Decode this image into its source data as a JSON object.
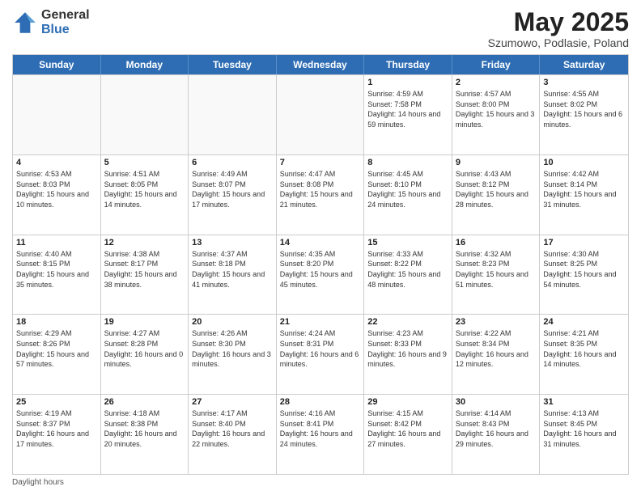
{
  "logo": {
    "general": "General",
    "blue": "Blue"
  },
  "title": {
    "month_year": "May 2025",
    "location": "Szumowo, Podlasie, Poland"
  },
  "days_of_week": [
    "Sunday",
    "Monday",
    "Tuesday",
    "Wednesday",
    "Thursday",
    "Friday",
    "Saturday"
  ],
  "weeks": [
    [
      {
        "day": "",
        "detail": "",
        "empty": true
      },
      {
        "day": "",
        "detail": "",
        "empty": true
      },
      {
        "day": "",
        "detail": "",
        "empty": true
      },
      {
        "day": "",
        "detail": "",
        "empty": true
      },
      {
        "day": "1",
        "detail": "Sunrise: 4:59 AM\nSunset: 7:58 PM\nDaylight: 14 hours\nand 59 minutes.",
        "empty": false
      },
      {
        "day": "2",
        "detail": "Sunrise: 4:57 AM\nSunset: 8:00 PM\nDaylight: 15 hours\nand 3 minutes.",
        "empty": false
      },
      {
        "day": "3",
        "detail": "Sunrise: 4:55 AM\nSunset: 8:02 PM\nDaylight: 15 hours\nand 6 minutes.",
        "empty": false
      }
    ],
    [
      {
        "day": "4",
        "detail": "Sunrise: 4:53 AM\nSunset: 8:03 PM\nDaylight: 15 hours\nand 10 minutes.",
        "empty": false
      },
      {
        "day": "5",
        "detail": "Sunrise: 4:51 AM\nSunset: 8:05 PM\nDaylight: 15 hours\nand 14 minutes.",
        "empty": false
      },
      {
        "day": "6",
        "detail": "Sunrise: 4:49 AM\nSunset: 8:07 PM\nDaylight: 15 hours\nand 17 minutes.",
        "empty": false
      },
      {
        "day": "7",
        "detail": "Sunrise: 4:47 AM\nSunset: 8:08 PM\nDaylight: 15 hours\nand 21 minutes.",
        "empty": false
      },
      {
        "day": "8",
        "detail": "Sunrise: 4:45 AM\nSunset: 8:10 PM\nDaylight: 15 hours\nand 24 minutes.",
        "empty": false
      },
      {
        "day": "9",
        "detail": "Sunrise: 4:43 AM\nSunset: 8:12 PM\nDaylight: 15 hours\nand 28 minutes.",
        "empty": false
      },
      {
        "day": "10",
        "detail": "Sunrise: 4:42 AM\nSunset: 8:14 PM\nDaylight: 15 hours\nand 31 minutes.",
        "empty": false
      }
    ],
    [
      {
        "day": "11",
        "detail": "Sunrise: 4:40 AM\nSunset: 8:15 PM\nDaylight: 15 hours\nand 35 minutes.",
        "empty": false
      },
      {
        "day": "12",
        "detail": "Sunrise: 4:38 AM\nSunset: 8:17 PM\nDaylight: 15 hours\nand 38 minutes.",
        "empty": false
      },
      {
        "day": "13",
        "detail": "Sunrise: 4:37 AM\nSunset: 8:18 PM\nDaylight: 15 hours\nand 41 minutes.",
        "empty": false
      },
      {
        "day": "14",
        "detail": "Sunrise: 4:35 AM\nSunset: 8:20 PM\nDaylight: 15 hours\nand 45 minutes.",
        "empty": false
      },
      {
        "day": "15",
        "detail": "Sunrise: 4:33 AM\nSunset: 8:22 PM\nDaylight: 15 hours\nand 48 minutes.",
        "empty": false
      },
      {
        "day": "16",
        "detail": "Sunrise: 4:32 AM\nSunset: 8:23 PM\nDaylight: 15 hours\nand 51 minutes.",
        "empty": false
      },
      {
        "day": "17",
        "detail": "Sunrise: 4:30 AM\nSunset: 8:25 PM\nDaylight: 15 hours\nand 54 minutes.",
        "empty": false
      }
    ],
    [
      {
        "day": "18",
        "detail": "Sunrise: 4:29 AM\nSunset: 8:26 PM\nDaylight: 15 hours\nand 57 minutes.",
        "empty": false
      },
      {
        "day": "19",
        "detail": "Sunrise: 4:27 AM\nSunset: 8:28 PM\nDaylight: 16 hours\nand 0 minutes.",
        "empty": false
      },
      {
        "day": "20",
        "detail": "Sunrise: 4:26 AM\nSunset: 8:30 PM\nDaylight: 16 hours\nand 3 minutes.",
        "empty": false
      },
      {
        "day": "21",
        "detail": "Sunrise: 4:24 AM\nSunset: 8:31 PM\nDaylight: 16 hours\nand 6 minutes.",
        "empty": false
      },
      {
        "day": "22",
        "detail": "Sunrise: 4:23 AM\nSunset: 8:33 PM\nDaylight: 16 hours\nand 9 minutes.",
        "empty": false
      },
      {
        "day": "23",
        "detail": "Sunrise: 4:22 AM\nSunset: 8:34 PM\nDaylight: 16 hours\nand 12 minutes.",
        "empty": false
      },
      {
        "day": "24",
        "detail": "Sunrise: 4:21 AM\nSunset: 8:35 PM\nDaylight: 16 hours\nand 14 minutes.",
        "empty": false
      }
    ],
    [
      {
        "day": "25",
        "detail": "Sunrise: 4:19 AM\nSunset: 8:37 PM\nDaylight: 16 hours\nand 17 minutes.",
        "empty": false
      },
      {
        "day": "26",
        "detail": "Sunrise: 4:18 AM\nSunset: 8:38 PM\nDaylight: 16 hours\nand 20 minutes.",
        "empty": false
      },
      {
        "day": "27",
        "detail": "Sunrise: 4:17 AM\nSunset: 8:40 PM\nDaylight: 16 hours\nand 22 minutes.",
        "empty": false
      },
      {
        "day": "28",
        "detail": "Sunrise: 4:16 AM\nSunset: 8:41 PM\nDaylight: 16 hours\nand 24 minutes.",
        "empty": false
      },
      {
        "day": "29",
        "detail": "Sunrise: 4:15 AM\nSunset: 8:42 PM\nDaylight: 16 hours\nand 27 minutes.",
        "empty": false
      },
      {
        "day": "30",
        "detail": "Sunrise: 4:14 AM\nSunset: 8:43 PM\nDaylight: 16 hours\nand 29 minutes.",
        "empty": false
      },
      {
        "day": "31",
        "detail": "Sunrise: 4:13 AM\nSunset: 8:45 PM\nDaylight: 16 hours\nand 31 minutes.",
        "empty": false
      }
    ]
  ],
  "footer": {
    "daylight_label": "Daylight hours"
  }
}
